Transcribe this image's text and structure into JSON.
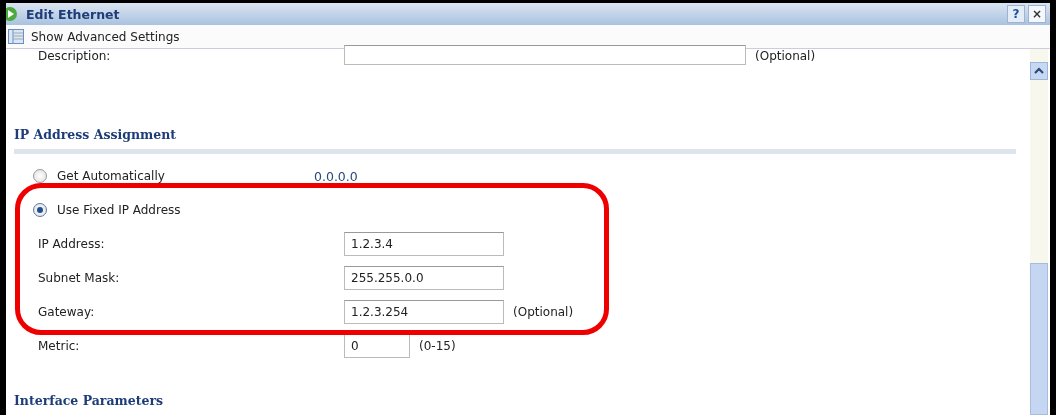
{
  "window": {
    "title": "Edit Ethernet",
    "buttons": [
      {
        "kind": "help",
        "label": "?"
      },
      {
        "kind": "close",
        "label": "×"
      }
    ]
  },
  "toolbar": {
    "link": "Show Advanced Settings"
  },
  "description": {
    "label": "Description:",
    "note": "(Optional)"
  },
  "ip_assignment": {
    "heading": "IP Address Assignment",
    "options": [
      {
        "label": "Get Automatically",
        "selected": false,
        "value": "0.0.0.0"
      },
      {
        "label": "Use Fixed IP Address",
        "selected": true
      }
    ],
    "fields": [
      {
        "label": "IP Address:",
        "value": "1.2.3.4"
      },
      {
        "label": "Subnet Mask:",
        "value": "255.255.0.0"
      },
      {
        "label": "Gateway:",
        "value": "1.2.3.254",
        "note": "(Optional)"
      }
    ],
    "metric": {
      "label": "Metric:",
      "value": "0",
      "note": "(0-15)"
    }
  },
  "interface_parameters": {
    "heading": "Interface Parameters"
  }
}
